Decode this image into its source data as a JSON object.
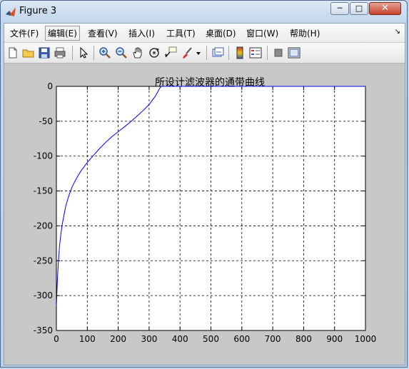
{
  "window": {
    "title": "Figure 3",
    "minimize": "─",
    "maximize": "□",
    "close": "✕"
  },
  "menu": [
    "文件(F)",
    "编辑(E)",
    "查看(V)",
    "插入(I)",
    "工具(T)",
    "桌面(D)",
    "窗口(W)",
    "帮助(H)"
  ],
  "menu_overflow": "↘",
  "toolbar_icons": [
    "new-figure-icon",
    "open-file-icon",
    "save-icon",
    "print-icon",
    "edit-plot-arrow-icon",
    "zoom-in-icon",
    "zoom-out-icon",
    "pan-hand-icon",
    "rotate-3d-icon",
    "data-cursor-icon",
    "brush-icon",
    "brush-dropdown-icon",
    "link-plot-icon",
    "colorbar-icon",
    "legend-icon",
    "hide-plot-tools-icon",
    "show-plot-tools-icon"
  ],
  "colors": {
    "curve": "#0000ff",
    "axes_bg": "#ffffff",
    "figure_bg": "#c8c8c8"
  },
  "chart_data": {
    "type": "line",
    "title": "所设计滤波器的通带曲线",
    "xlabel": "",
    "ylabel": "",
    "xlim": [
      0,
      1000
    ],
    "ylim": [
      -350,
      0
    ],
    "xticks": [
      "0",
      "100",
      "200",
      "300",
      "400",
      "500",
      "600",
      "700",
      "800",
      "900",
      "1000"
    ],
    "yticks": [
      "0",
      "-50",
      "-100",
      "-150",
      "-200",
      "-250",
      "-300",
      "-350"
    ],
    "grid": true,
    "series": [
      {
        "x": [
          0,
          3,
          6,
          10,
          15,
          20,
          30,
          40,
          50,
          60,
          70,
          80,
          90,
          100,
          120,
          140,
          160,
          180,
          200,
          220,
          240,
          260,
          280,
          300,
          320,
          335,
          340,
          400,
          500,
          600,
          700,
          800,
          900,
          1000
        ],
        "y": [
          -315,
          -280,
          -255,
          -230,
          -210,
          -195,
          -172,
          -157,
          -145,
          -136,
          -128,
          -121,
          -115,
          -109,
          -99,
          -89,
          -80,
          -72,
          -65,
          -58,
          -51,
          -43,
          -35,
          -26,
          -14,
          -2,
          0,
          0,
          0,
          0,
          0,
          0,
          0,
          0
        ]
      }
    ]
  }
}
